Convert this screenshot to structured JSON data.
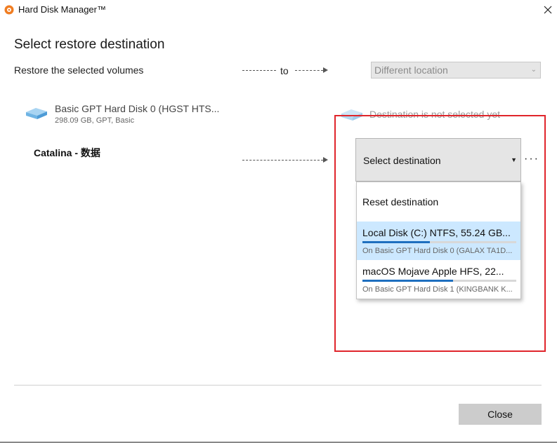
{
  "window": {
    "app_title": "Hard Disk Manager™",
    "close_glyph": "✕"
  },
  "page": {
    "heading": "Select restore destination",
    "subtitle": "Restore the selected volumes",
    "to_label": "to",
    "location_select": {
      "value": "Different location"
    }
  },
  "source_disk": {
    "name": "Basic GPT Hard Disk 0 (HGST HTS...",
    "info": "298.09 GB, GPT, Basic",
    "icon": "hard-disk-icon"
  },
  "destination": {
    "placeholder_text": "Destination is not selected yet",
    "icon": "hard-disk-icon"
  },
  "volume": {
    "name": "Catalina - 数据"
  },
  "destination_select": {
    "label": "Select destination",
    "caret": "▼",
    "more_label": "···"
  },
  "dropdown": {
    "reset_label": "Reset destination",
    "items": [
      {
        "title": "Local Disk (C:) NTFS, 55.24 GB...",
        "subtitle": "On Basic GPT Hard Disk 0 (GALAX TA1D...",
        "usage": 0.44,
        "selected": true
      },
      {
        "title": "macOS Mojave Apple HFS, 22...",
        "subtitle": "On Basic GPT Hard Disk 1 (KINGBANK K...",
        "usage": 0.59,
        "selected": false
      }
    ]
  },
  "footer": {
    "close_label": "Close"
  },
  "colors": {
    "highlight_box": "#e0252b",
    "usage_fill": "#1e6fbf",
    "selected_row": "#cce8ff"
  }
}
